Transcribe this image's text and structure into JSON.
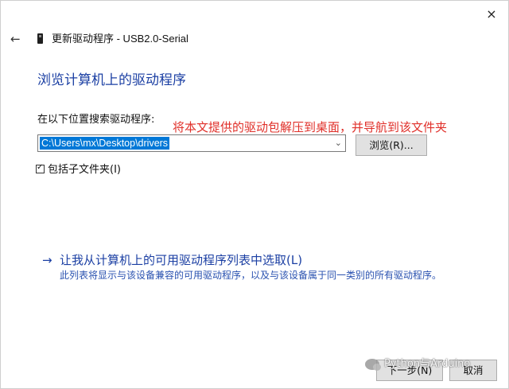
{
  "window": {
    "title": "更新驱动程序 - USB2.0-Serial",
    "close_icon": "×",
    "back_icon": "←"
  },
  "heading": "浏览计算机上的驱动程序",
  "search": {
    "label": "在以下位置搜索驱动程序:",
    "path_value": "C:\\Users\\mx\\Desktop\\drivers",
    "dropdown_icon": "⌄",
    "browse_label": "浏览(R)..."
  },
  "annotation": "将本文提供的驱动包解压到桌面，并导航到该文件夹",
  "checkbox": {
    "label": "包括子文件夹(I)",
    "checked": true
  },
  "pick": {
    "arrow": "→",
    "link": "让我从计算机上的可用驱动程序列表中选取(L)",
    "description": "此列表将显示与该设备兼容的可用驱动程序，以及与该设备属于同一类别的所有驱动程序。"
  },
  "footer": {
    "next_label": "下一步(N)",
    "cancel_label": "取消"
  },
  "watermark": {
    "text": "Python与Arduino"
  },
  "colors": {
    "heading": "#1b3fa3",
    "annotation": "#e0302a",
    "selection": "#0078d7"
  }
}
